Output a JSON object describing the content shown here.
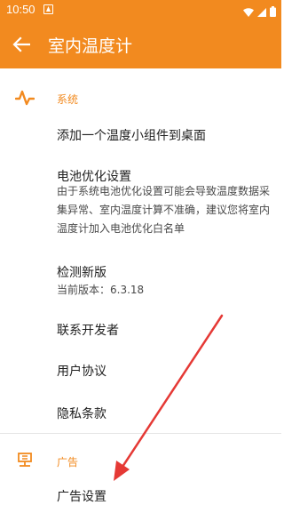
{
  "status_bar": {
    "time": "10:50",
    "icons": [
      "notification-a-icon",
      "wifi-icon",
      "signal-icon",
      "battery-icon"
    ]
  },
  "app_bar": {
    "title": "室内温度计",
    "back_icon": "arrow-left-icon",
    "background_color": "#f28a1f"
  },
  "sections": {
    "system": {
      "title": "系统",
      "icon": "waveform-icon",
      "items": {
        "add_widget": {
          "title": "添加一个温度小组件到桌面"
        },
        "battery_opt": {
          "title": "电池优化设置",
          "summary": "由于系统电池优化设置可能会导致温度数据采集异常、室内温度计算不准确，建议您将室内温度计加入电池优化白名单"
        },
        "check_update": {
          "title": "检测新版",
          "summary": "当前版本：6.3.18"
        },
        "contact_dev": {
          "title": "联系开发者"
        },
        "user_agreement": {
          "title": "用户协议"
        },
        "privacy": {
          "title": "隐私条款"
        }
      }
    },
    "ads": {
      "title": "广告",
      "icon": "ad-icon",
      "items": {
        "ad_settings": {
          "title": "广告设置"
        }
      }
    }
  },
  "colors": {
    "accent": "#f28a1f",
    "annotation_arrow": "#e53935"
  }
}
